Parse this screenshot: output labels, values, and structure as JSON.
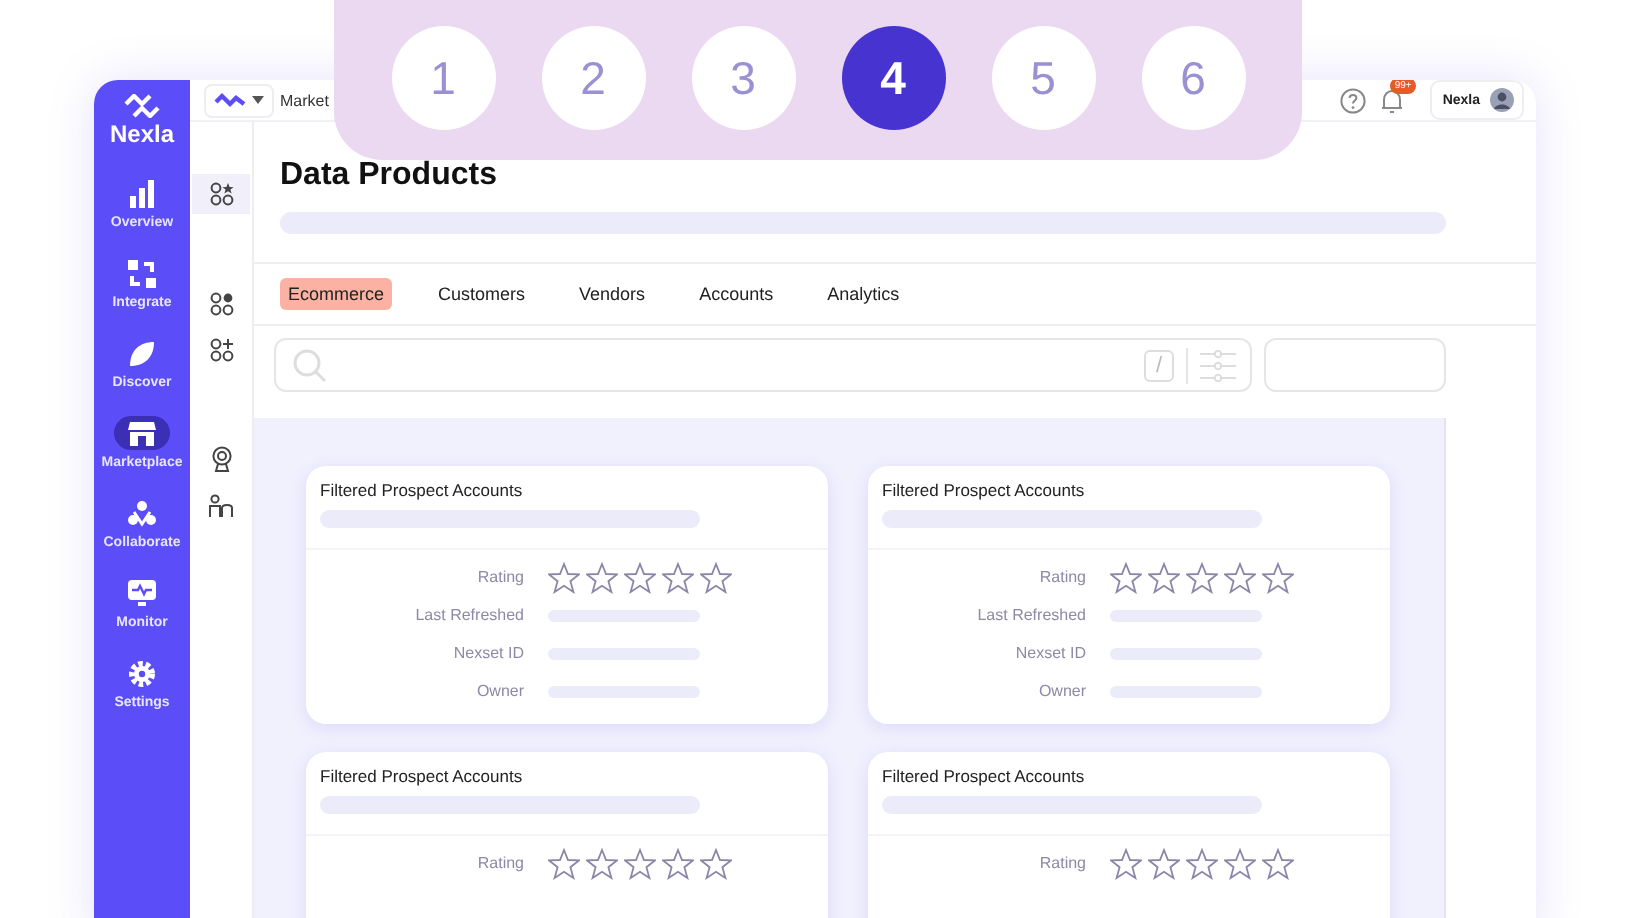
{
  "steps": [
    {
      "label": "1",
      "selected": false
    },
    {
      "label": "2",
      "selected": false
    },
    {
      "label": "3",
      "selected": false
    },
    {
      "label": "4",
      "selected": true
    },
    {
      "label": "5",
      "selected": false
    },
    {
      "label": "6",
      "selected": false
    }
  ],
  "brand": {
    "name": "Nexla"
  },
  "sidebar": {
    "items": [
      {
        "label": "Overview",
        "kind": "chart",
        "selected": false
      },
      {
        "label": "Integrate",
        "kind": "integrate",
        "selected": false
      },
      {
        "label": "Discover",
        "kind": "compass",
        "selected": false
      },
      {
        "label": "Marketplace",
        "kind": "store",
        "selected": true
      },
      {
        "label": "Collaborate",
        "kind": "people",
        "selected": false
      },
      {
        "label": "Monitor",
        "kind": "monitor",
        "selected": false
      },
      {
        "label": "Settings",
        "kind": "gear",
        "selected": false
      }
    ]
  },
  "topbar": {
    "breadcrumb": "Market",
    "notification_badge": "99+",
    "user": "Nexla"
  },
  "rail": [
    {
      "kind": "grid-star",
      "selected": true
    },
    {
      "kind": "grid-dot",
      "selected": false
    },
    {
      "kind": "grid-plus",
      "selected": false
    },
    {
      "kind": "award",
      "selected": false
    },
    {
      "kind": "users",
      "selected": false
    }
  ],
  "page": {
    "title": "Data Products"
  },
  "tabs": [
    {
      "label": "Ecommerce",
      "selected": true
    },
    {
      "label": "Customers",
      "selected": false
    },
    {
      "label": "Vendors",
      "selected": false
    },
    {
      "label": "Accounts",
      "selected": false
    },
    {
      "label": "Analytics",
      "selected": false
    }
  ],
  "search": {
    "shortcut": "/"
  },
  "cards": [
    {
      "title": "Filtered Prospect Accounts",
      "fields": [
        {
          "label": "Rating",
          "kind": "stars",
          "stars": 0
        },
        {
          "label": "Last Refreshed",
          "kind": "skeleton"
        },
        {
          "label": "Nexset ID",
          "kind": "skeleton"
        },
        {
          "label": "Owner",
          "kind": "skeleton"
        }
      ]
    },
    {
      "title": "Filtered Prospect Accounts",
      "fields": [
        {
          "label": "Rating",
          "kind": "stars",
          "stars": 0
        },
        {
          "label": "Last Refreshed",
          "kind": "skeleton"
        },
        {
          "label": "Nexset ID",
          "kind": "skeleton"
        },
        {
          "label": "Owner",
          "kind": "skeleton"
        }
      ]
    },
    {
      "title": "Filtered Prospect Accounts",
      "fields": [
        {
          "label": "Rating",
          "kind": "stars",
          "stars": 0
        }
      ]
    },
    {
      "title": "Filtered Prospect Accounts",
      "fields": [
        {
          "label": "Rating",
          "kind": "stars",
          "stars": 0
        }
      ]
    }
  ]
}
